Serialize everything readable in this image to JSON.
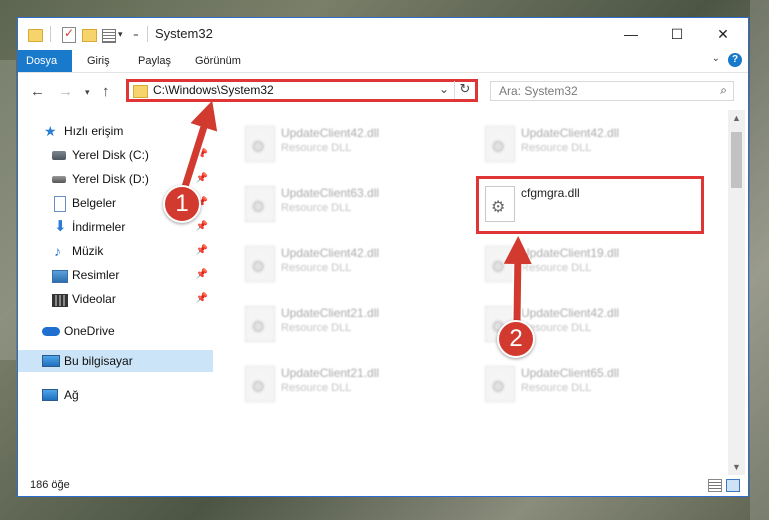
{
  "window": {
    "title": "System32",
    "controls": {
      "minimize": "—",
      "maximize": "☐",
      "close": "✕"
    }
  },
  "ribbon": {
    "tabs": [
      {
        "label": "Dosya"
      },
      {
        "label": "Giriş"
      },
      {
        "label": "Paylaş"
      },
      {
        "label": "Görünüm"
      }
    ]
  },
  "address": {
    "path": "C:\\Windows\\System32",
    "refresh_glyph": "↻",
    "dropdown_glyph": "⌄"
  },
  "search": {
    "placeholder": "Ara: System32"
  },
  "sidebar": {
    "items": [
      {
        "label": "Hızlı erişim",
        "icon": "star-icon"
      },
      {
        "label": "Yerel Disk (C:)",
        "icon": "drive-icon",
        "pinned": true
      },
      {
        "label": "Yerel Disk (D:)",
        "icon": "drive-icon",
        "pinned": true
      },
      {
        "label": "Belgeler",
        "icon": "document-icon",
        "pinned": true
      },
      {
        "label": "İndirmeler",
        "icon": "download-icon",
        "pinned": true
      },
      {
        "label": "Müzik",
        "icon": "music-icon",
        "pinned": true
      },
      {
        "label": "Resimler",
        "icon": "pictures-icon",
        "pinned": true
      },
      {
        "label": "Videolar",
        "icon": "videos-icon",
        "pinned": true
      },
      {
        "label": "OneDrive",
        "icon": "onedrive-icon"
      },
      {
        "label": "Bu bilgisayar",
        "icon": "computer-icon",
        "selected": true
      },
      {
        "label": "Ağ",
        "icon": "network-icon"
      }
    ]
  },
  "files": [
    {
      "name": "UpdateClient42.dll",
      "type": "Resource DLL"
    },
    {
      "name": "UpdateClient42.dll",
      "type": "Resource DLL"
    },
    {
      "name": "UpdateClient63.dll",
      "type": "Resource DLL"
    },
    {
      "name": "cfgmgra.dll",
      "type": ""
    },
    {
      "name": "UpdateClient42.dll",
      "type": "Resource DLL"
    },
    {
      "name": "UpdateClient19.dll",
      "type": "Resource DLL"
    },
    {
      "name": "UpdateClient21.dll",
      "type": "Resource DLL"
    },
    {
      "name": "UpdateClient42.dll",
      "type": "Resource DLL"
    },
    {
      "name": "UpdateClient21.dll",
      "type": "Resource DLL"
    },
    {
      "name": "UpdateClient65.dll",
      "type": "Resource DLL"
    }
  ],
  "status": {
    "item_count": "186 öğe"
  },
  "annotations": {
    "marker_1": "1",
    "marker_2": "2"
  },
  "colors": {
    "accent": "#1979ca",
    "highlight": "#e03535",
    "marker": "#d23a2f",
    "selection": "#cce4f7"
  }
}
